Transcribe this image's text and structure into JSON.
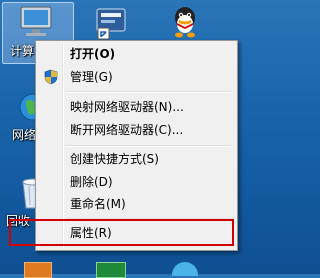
{
  "desktop": {
    "icons": [
      {
        "name": "computer-icon",
        "label": "计算"
      },
      {
        "name": "shortcut-app-icon",
        "label": ""
      },
      {
        "name": "qq-icon",
        "label": ""
      },
      {
        "name": "network-icon",
        "label": "网络"
      },
      {
        "name": "recycle-bin-icon",
        "label": "回收"
      }
    ]
  },
  "context_menu": {
    "items": [
      {
        "label": "打开(O)",
        "bold": true
      },
      {
        "label": "管理(G)",
        "icon": "shield-icon"
      },
      {
        "label": "映射网络驱动器(N)..."
      },
      {
        "label": "断开网络驱动器(C)..."
      },
      {
        "label": "创建快捷方式(S)"
      },
      {
        "label": "删除(D)"
      },
      {
        "label": "重命名(M)"
      },
      {
        "label": "属性(R)",
        "highlighted": true
      }
    ]
  },
  "colors": {
    "highlight_border": "#d40000",
    "desktop_bg": "#1c66ad"
  }
}
